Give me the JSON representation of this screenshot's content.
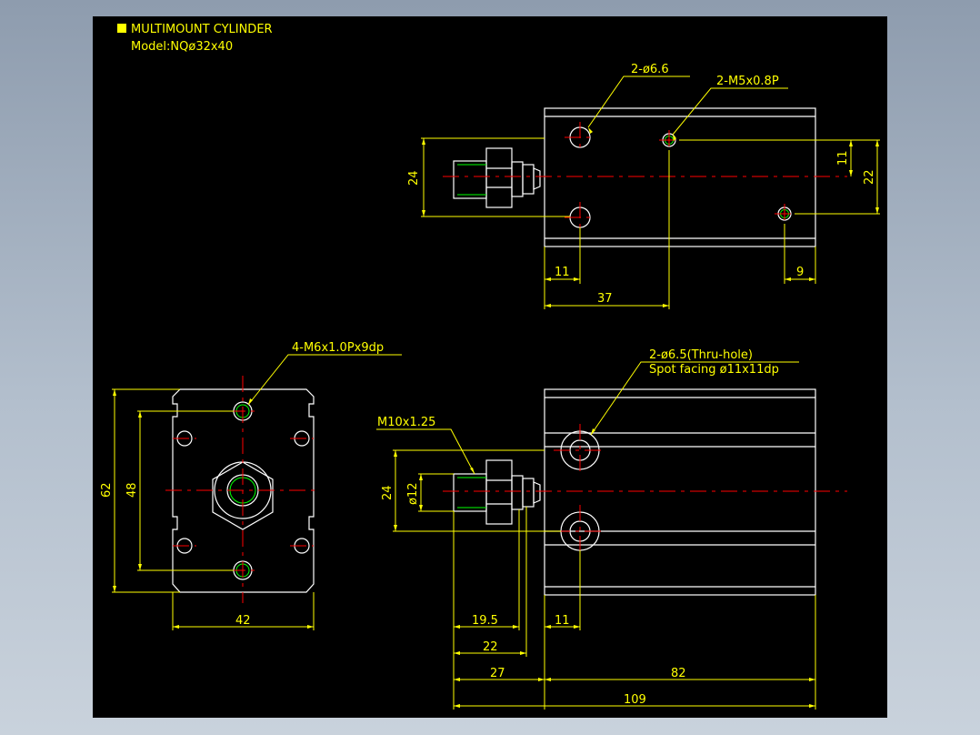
{
  "title": {
    "line1": "MULTIMOUNT CYLINDER",
    "line2": "Model:NQø32x40"
  },
  "callouts": {
    "top_hole": "2-ø6.6",
    "top_tap": "2-M5x0.8P",
    "side_tap": "4-M6x1.0Px9dp",
    "bottom_hole_1": "2-ø6.5(Thru-hole)",
    "bottom_hole_2": "Spot facing ø11x11dp",
    "rod_thread": "M10x1.25"
  },
  "dims": {
    "top_24": "24",
    "top_11v": "11",
    "top_22": "22",
    "top_11h": "11",
    "top_9": "9",
    "top_37": "37",
    "side_62": "62",
    "side_48": "48",
    "side_42": "42",
    "bot_24": "24",
    "bot_d12": "ø12",
    "bot_195": "19.5",
    "bot_22": "22",
    "bot_11": "11",
    "bot_27": "27",
    "bot_82": "82",
    "bot_109": "109"
  },
  "colors": {
    "background": "#000000",
    "dimension": "#ffff00",
    "outline": "#ffffff",
    "centerline": "#ff0000",
    "thread": "#00ff00",
    "marker": "#ffff00"
  }
}
